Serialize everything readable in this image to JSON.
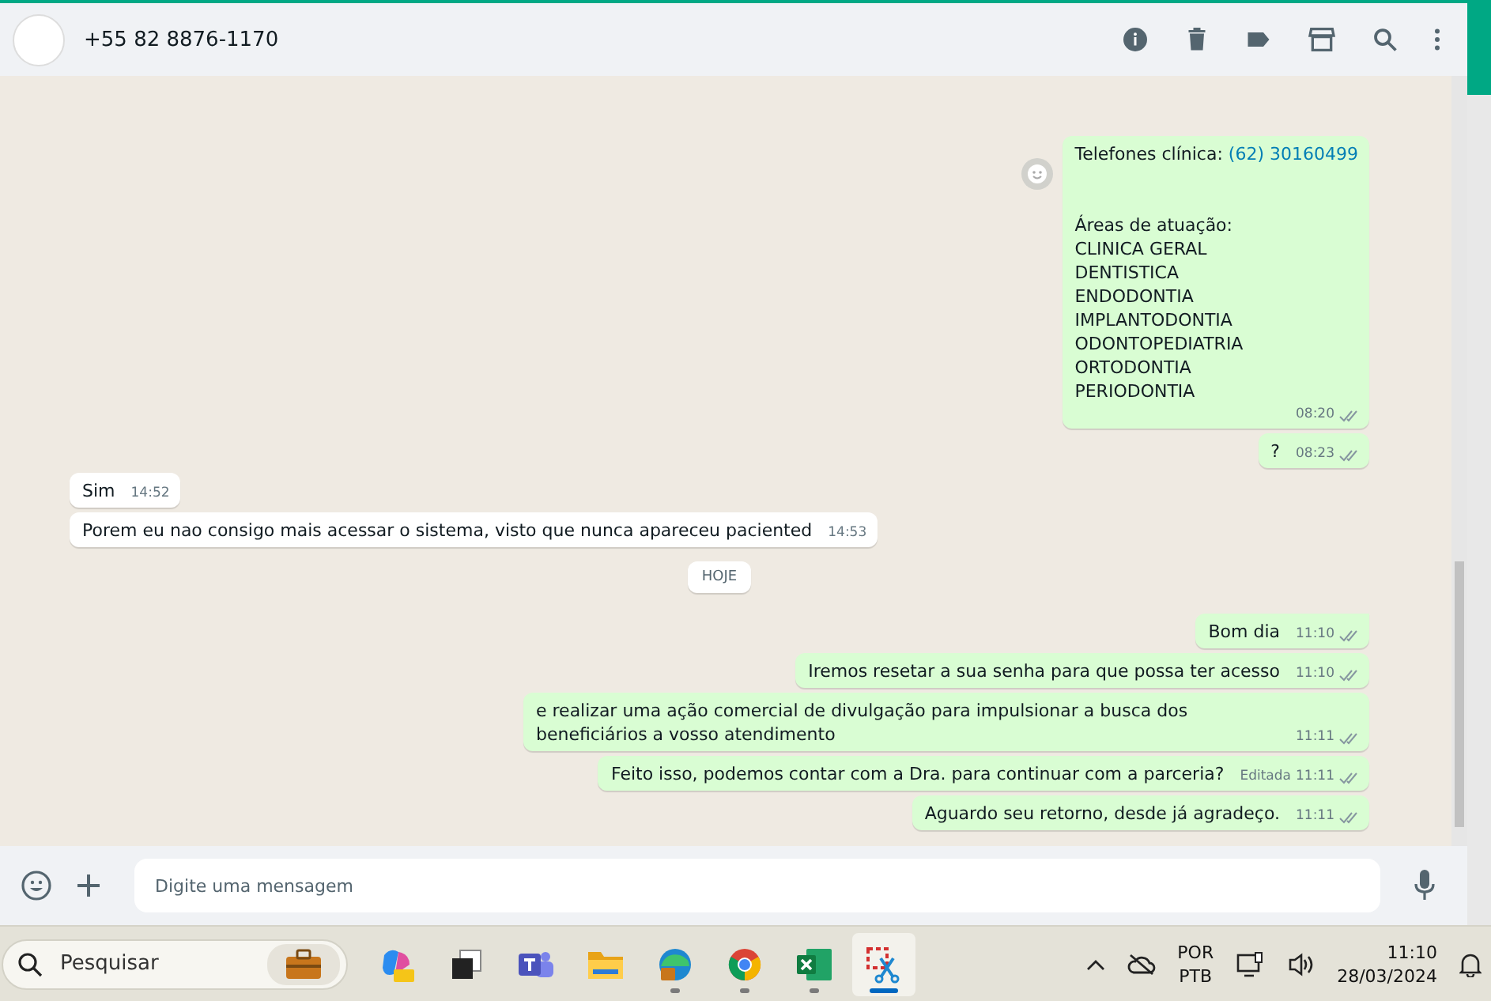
{
  "header": {
    "contact": "+55 82 8876-1170"
  },
  "messages": [
    {
      "kind": "out",
      "lead": {
        "text": "Telefones clínica:",
        "link": "(62) 30160499"
      },
      "lines": [
        "Áreas de atuação:",
        "CLINICA GERAL",
        "DENTISTICA",
        "ENDODONTIA",
        "IMPLANTODONTIA",
        "ODONTOPEDIATRIA",
        "ORTODONTIA",
        "PERIODONTIA"
      ],
      "time": "08:20",
      "read": false,
      "reaction_button": true
    },
    {
      "kind": "out",
      "lines": [
        "?"
      ],
      "time": "08:23",
      "read": false
    },
    {
      "kind": "in",
      "lines": [
        "Sim"
      ],
      "time": "14:52"
    },
    {
      "kind": "in",
      "lines": [
        "Porem eu nao consigo mais acessar o sistema, visto que nunca apareceu paciented"
      ],
      "time": "14:53"
    },
    {
      "kind": "date",
      "text": "HOJE"
    },
    {
      "kind": "out",
      "lines": [
        "Bom dia"
      ],
      "time": "11:10",
      "read": false,
      "tail": true
    },
    {
      "kind": "out",
      "lines": [
        "Iremos resetar a sua senha para que possa ter acesso"
      ],
      "time": "11:10",
      "read": false
    },
    {
      "kind": "out",
      "lines": [
        "e realizar uma ação comercial de divulgação para impulsionar a busca dos beneficiários a vosso atendimento"
      ],
      "time": "11:11",
      "read": false
    },
    {
      "kind": "out",
      "lines": [
        "Feito isso, podemos contar com a Dra. para continuar com a parceria?"
      ],
      "edited_label": "Editada",
      "time": "11:11",
      "read": false
    },
    {
      "kind": "out",
      "lines": [
        "Aguardo seu retorno, desde já agradeço."
      ],
      "time": "11:11",
      "read": false
    }
  ],
  "composer": {
    "placeholder": "Digite uma mensagem"
  },
  "taskbar": {
    "search": {
      "placeholder": "Pesquisar"
    },
    "apps": [
      {
        "kind": "copilot",
        "running": false,
        "active": false
      },
      {
        "kind": "taskview",
        "running": false,
        "active": false
      },
      {
        "kind": "teams",
        "running": false,
        "active": false
      },
      {
        "kind": "files",
        "running": false,
        "active": false
      },
      {
        "kind": "edge",
        "running": true,
        "active": false
      },
      {
        "kind": "chrome",
        "running": true,
        "active": false
      },
      {
        "kind": "excel",
        "running": true,
        "active": false
      },
      {
        "kind": "snip",
        "running": true,
        "active": true
      }
    ],
    "language": [
      "POR",
      "PTB"
    ],
    "time": "11:10",
    "date": "28/03/2024"
  }
}
